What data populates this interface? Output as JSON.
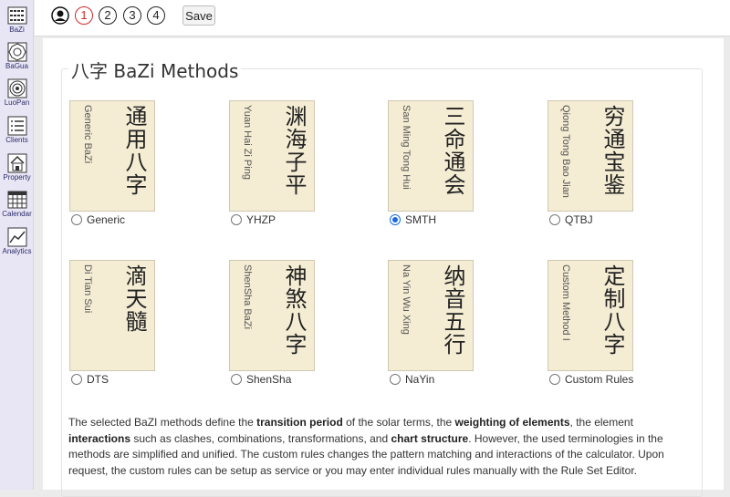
{
  "sidebar": {
    "items": [
      {
        "label": "BaZi",
        "icon": "bazi-grid-icon"
      },
      {
        "label": "BaGua",
        "icon": "bagua-icon"
      },
      {
        "label": "LuoPan",
        "icon": "luopan-compass-icon"
      },
      {
        "label": "Clients",
        "icon": "clients-list-icon"
      },
      {
        "label": "Property",
        "icon": "property-house-icon"
      },
      {
        "label": "Calendar",
        "icon": "calendar-grid-icon"
      },
      {
        "label": "Analytics",
        "icon": "analytics-chart-icon"
      }
    ]
  },
  "toolbar": {
    "steps": [
      "1",
      "2",
      "3",
      "4"
    ],
    "active_step": "1",
    "save_label": "Save",
    "active_color": "#d32a2a"
  },
  "page": {
    "title": "八字 BaZi Methods"
  },
  "methods": [
    {
      "cjk": "通用八字",
      "latin": "Generic BaZi",
      "label": "Generic",
      "checked": false
    },
    {
      "cjk": "渊海子平",
      "latin": "Yuan Hai Zi Ping",
      "label": "YHZP",
      "checked": false
    },
    {
      "cjk": "三命通会",
      "latin": "San Ming Tong Hui",
      "label": "SMTH",
      "checked": true
    },
    {
      "cjk": "穷通宝鉴",
      "latin": "Qiong Tong Bao Jian",
      "label": "QTBJ",
      "checked": false
    },
    {
      "cjk": "滴天髓",
      "latin": "Di Tian Sui",
      "label": "DTS",
      "checked": false
    },
    {
      "cjk": "神煞八字",
      "latin": "ShenSha BaZi",
      "label": "ShenSha",
      "checked": false
    },
    {
      "cjk": "纳音五行",
      "latin": "Na Yin Wu Xing",
      "label": "NaYin",
      "checked": false
    },
    {
      "cjk": "定制八字",
      "latin": "Custom Method I",
      "label": "Custom Rules",
      "checked": false
    }
  ],
  "description": {
    "t1": "The selected BaZI methods define the ",
    "b1": "transition period",
    "t2": " of the solar terms, the ",
    "b2": "weighting of elements",
    "t3": ", the element ",
    "b3": "interactions",
    "t4": " such as clashes, combinations, transformations, and ",
    "b4": "chart structure",
    "t5": ". However, the used terminologies in the methods are simplified and unified. The custom rules changes the pattern matching and interactions of the calculator. Upon request, the custom rules can be setup as service or you may enter individual rules manually with the Rule Set Editor."
  },
  "colors": {
    "tile_bg": "#f4ecd3",
    "sidebar_bg": "#e8e6f4",
    "radio_accent": "#1a6be0"
  }
}
